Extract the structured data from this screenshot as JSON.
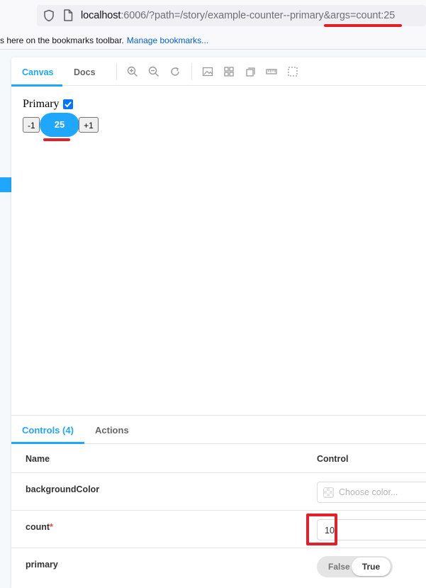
{
  "browser": {
    "url_host": "localhost",
    "url_rest": ":6006/?path=/story/example-counter--primary&args=count:25",
    "bookmarks_message": "s here on the bookmarks toolbar.",
    "bookmarks_link": "Manage bookmarks..."
  },
  "toolbar": {
    "tabs": [
      "Canvas",
      "Docs"
    ],
    "active_tab": "Canvas",
    "tools": [
      "zoom-in-icon",
      "zoom-out-icon",
      "zoom-reset-icon",
      "background-icon",
      "grid-icon",
      "viewport-icon",
      "measure-icon",
      "outline-icon"
    ]
  },
  "story": {
    "primary_label": "Primary",
    "primary_checked": true,
    "decrement_label": "-1",
    "count_value": "25",
    "increment_label": "+1"
  },
  "addons": {
    "tabs": [
      "Controls (4)",
      "Actions"
    ],
    "active_tab": "Controls (4)"
  },
  "controls": {
    "header_name": "Name",
    "header_control": "Control",
    "rows": [
      {
        "name": "backgroundColor",
        "required": false,
        "placeholder": "Choose color..."
      },
      {
        "name": "count",
        "required": true,
        "value": "10"
      },
      {
        "name": "primary",
        "required": false,
        "off_label": "False",
        "on_label": "True",
        "value": true
      }
    ],
    "required_marker": "*"
  },
  "colors": {
    "accent": "#1ea7fd",
    "annotation_red": "#e3202a",
    "checkbox_blue": "#0075ff"
  }
}
